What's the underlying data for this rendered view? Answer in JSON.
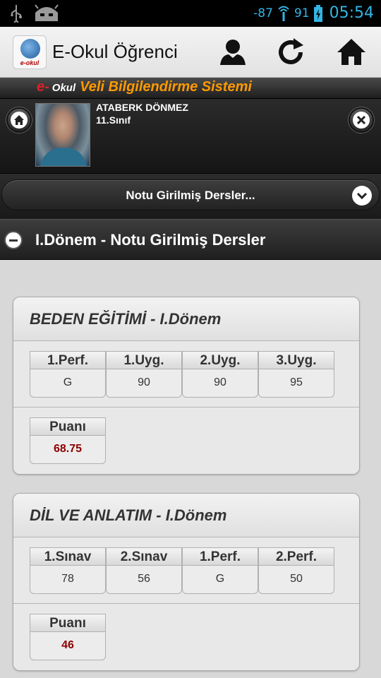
{
  "status_bar": {
    "signal": "-87",
    "battery": "91",
    "time": "05:54",
    "icons": [
      "usb-icon",
      "android-icon",
      "wifi-icon",
      "battery-icon"
    ]
  },
  "action_bar": {
    "logo_text": "e-okul",
    "title": "E-Okul Öğrenci",
    "icons": [
      "profile-icon",
      "refresh-icon",
      "home-icon"
    ]
  },
  "banner": {
    "prefix": "e-",
    "okul": "Okul",
    "title": "Veli Bilgilendirme Sistemi"
  },
  "student": {
    "name": "ATABERK DÖNMEZ",
    "class": "11.Sınıf"
  },
  "select": {
    "label": "Notu Girilmiş Dersler..."
  },
  "section": {
    "title": "I.Dönem - Notu Girilmiş Dersler"
  },
  "courses": [
    {
      "title": "BEDEN EĞİTİMİ - I.Dönem",
      "grades": [
        {
          "label": "1.Perf.",
          "value": "G"
        },
        {
          "label": "1.Uyg.",
          "value": "90"
        },
        {
          "label": "2.Uyg.",
          "value": "90"
        },
        {
          "label": "3.Uyg.",
          "value": "95"
        }
      ],
      "score_label": "Puanı",
      "score": "68.75"
    },
    {
      "title": "DİL VE ANLATIM - I.Dönem",
      "grades": [
        {
          "label": "1.Sınav",
          "value": "78"
        },
        {
          "label": "2.Sınav",
          "value": "56"
        },
        {
          "label": "1.Perf.",
          "value": "G"
        },
        {
          "label": "2.Perf.",
          "value": "50"
        }
      ],
      "score_label": "Puanı",
      "score": "46"
    }
  ],
  "colors": {
    "accent": "#33b5e5",
    "banner_orange": "#ff9a00",
    "banner_red": "#e0202a",
    "score_red": "#8b0000"
  }
}
